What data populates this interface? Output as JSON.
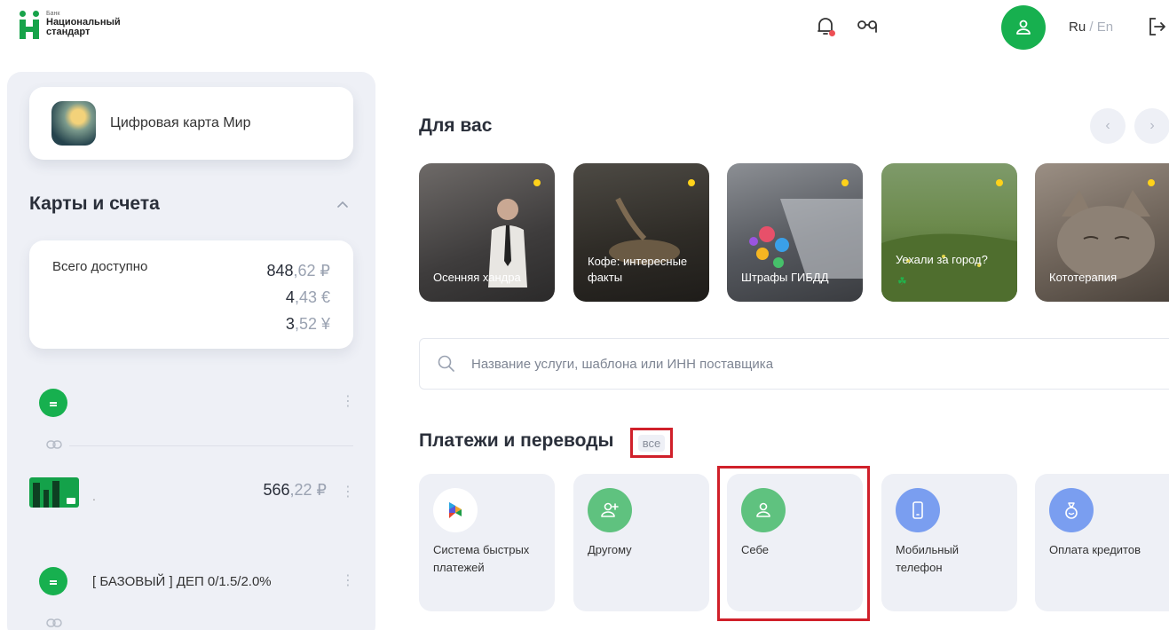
{
  "header": {
    "logo": {
      "line1": "Банк",
      "line2": "Национальный",
      "line3": "стандарт"
    },
    "icons": [
      "bell-icon",
      "glasses-icon",
      "user-icon",
      "logout-icon"
    ],
    "lang": {
      "ru": "Ru",
      "sep": "/",
      "en": "En"
    }
  },
  "sidebar": {
    "digital_card": {
      "label": "Цифровая карта Мир"
    },
    "section_title": "Карты и счета",
    "total": {
      "label": "Всего доступно",
      "amounts": [
        {
          "int": "848",
          "dec": ",62",
          "cur": "₽"
        },
        {
          "int": "4",
          "dec": ",43",
          "cur": "€"
        },
        {
          "int": "3",
          "dec": ",52",
          "cur": "¥"
        }
      ]
    },
    "accounts": [
      {
        "name": "",
        "amount": ""
      },
      {
        "card_suffix": ".",
        "amount_int": "566",
        "amount_dec": ",22",
        "currency": "₽"
      },
      {
        "name": "[ БАЗОВЫЙ ] ДЕП 0/1.5/2.0%"
      }
    ],
    "more_glyph": "⋮"
  },
  "main": {
    "for_you": {
      "title": "Для вас",
      "prev_glyph": "‹",
      "next_glyph": "›",
      "stories": [
        {
          "label": "Осенняя хандра"
        },
        {
          "label": "Кофе: интересные факты"
        },
        {
          "label": "Штрафы ГИБДД"
        },
        {
          "label": "Уехали за город?"
        },
        {
          "label": "Кототерапия"
        }
      ],
      "clover": "☘"
    },
    "search": {
      "placeholder": "Название услуги, шаблона или ИНН поставщика"
    },
    "payments": {
      "title": "Платежи и переводы",
      "all_link": "все",
      "tiles": [
        {
          "label": "Система быстрых платежей",
          "icon": "sbp-icon"
        },
        {
          "label": "Другому",
          "icon": "add-user-icon"
        },
        {
          "label": "Себе",
          "icon": "user-icon"
        },
        {
          "label": "Мобильный телефон",
          "icon": "phone-icon"
        },
        {
          "label": "Оплата кредитов",
          "icon": "money-bag-icon"
        }
      ]
    }
  },
  "colors": {
    "brand_green": "#17b04f",
    "accent_blue": "#7a9ef0",
    "highlight_red": "#d0202a",
    "story_dot": "#ffd21a"
  }
}
